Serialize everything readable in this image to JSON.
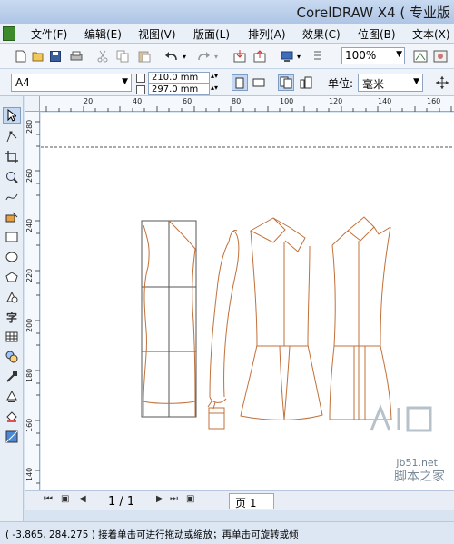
{
  "window": {
    "title": "CorelDRAW X4 ( 专业版"
  },
  "menu": {
    "items": [
      {
        "label": "文件(F)"
      },
      {
        "label": "编辑(E)"
      },
      {
        "label": "视图(V)"
      },
      {
        "label": "版面(L)"
      },
      {
        "label": "排列(A)"
      },
      {
        "label": "效果(C)"
      },
      {
        "label": "位图(B)"
      },
      {
        "label": "文本(X)"
      }
    ]
  },
  "toolbar": {
    "icons": [
      "new-icon",
      "open-icon",
      "save-icon",
      "print-icon",
      "cut-icon",
      "copy-icon",
      "paste-icon",
      "undo-icon",
      "redo-icon",
      "import-icon",
      "export-icon",
      "app-launcher-icon",
      "welcome-icon"
    ],
    "zoom": "100%"
  },
  "property_bar": {
    "paper_size": "A4",
    "width": "210.0 mm",
    "height": "297.0 mm",
    "unit_label": "单位:",
    "unit_value": "毫米"
  },
  "toolbox": {
    "tools": [
      "pick-tool-icon",
      "shape-tool-icon",
      "crop-tool-icon",
      "zoom-tool-icon",
      "freehand-tool-icon",
      "smart-fill-tool-icon",
      "rectangle-tool-icon",
      "ellipse-tool-icon",
      "polygon-tool-icon",
      "basic-shapes-tool-icon",
      "text-tool-icon",
      "table-tool-icon",
      "interactive-tool-icon",
      "eyedropper-tool-icon",
      "outline-tool-icon",
      "fill-tool-icon",
      "interactive-fill-tool-icon"
    ],
    "text_tool_label": "字"
  },
  "rulers": {
    "horizontal": [
      "20",
      "40",
      "60",
      "80",
      "100",
      "120",
      "140",
      "160"
    ],
    "vertical": [
      "280",
      "260",
      "240",
      "220",
      "200",
      "180",
      "160",
      "140"
    ]
  },
  "page_nav": {
    "count": "1 / 1",
    "tab": "页 1"
  },
  "status": {
    "text": "( -3.865, 284.275 ) 接着单击可进行拖动或缩放；再单击可旋转或倾"
  },
  "watermark": {
    "site": "jb51.net",
    "text": "脚本之家"
  },
  "colors": {
    "garment_outline": "#c0703a",
    "pattern_outline": "#555555"
  }
}
